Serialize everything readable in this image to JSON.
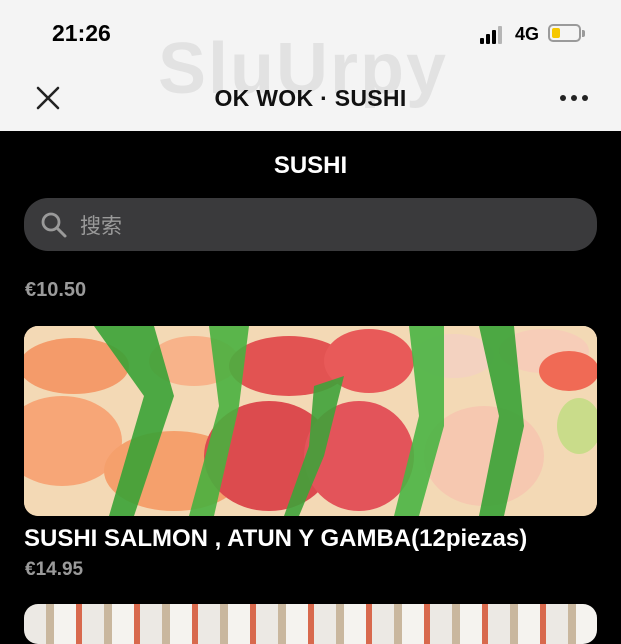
{
  "status_bar": {
    "time": "21:26",
    "network": "4G",
    "battery_level": 0.3,
    "signal_bars": 3
  },
  "header": {
    "title": "OK WOK · SUSHI",
    "close_icon": "close-icon",
    "more_icon": "more-icon"
  },
  "watermark": "SluUrpy",
  "section": {
    "title": "SUSHI"
  },
  "search": {
    "placeholder": "搜索",
    "icon": "search-icon"
  },
  "items": [
    {
      "price": "€10.50"
    },
    {
      "name": "SUSHI SALMON , ATUN Y GAMBA(12piezas)",
      "price": "€14.95"
    }
  ],
  "colors": {
    "background": "#000000",
    "header_bg": "#f4f4f4",
    "search_bg": "#3a3a3c",
    "price_text": "#9a9a9a",
    "battery": "#f6c700"
  }
}
